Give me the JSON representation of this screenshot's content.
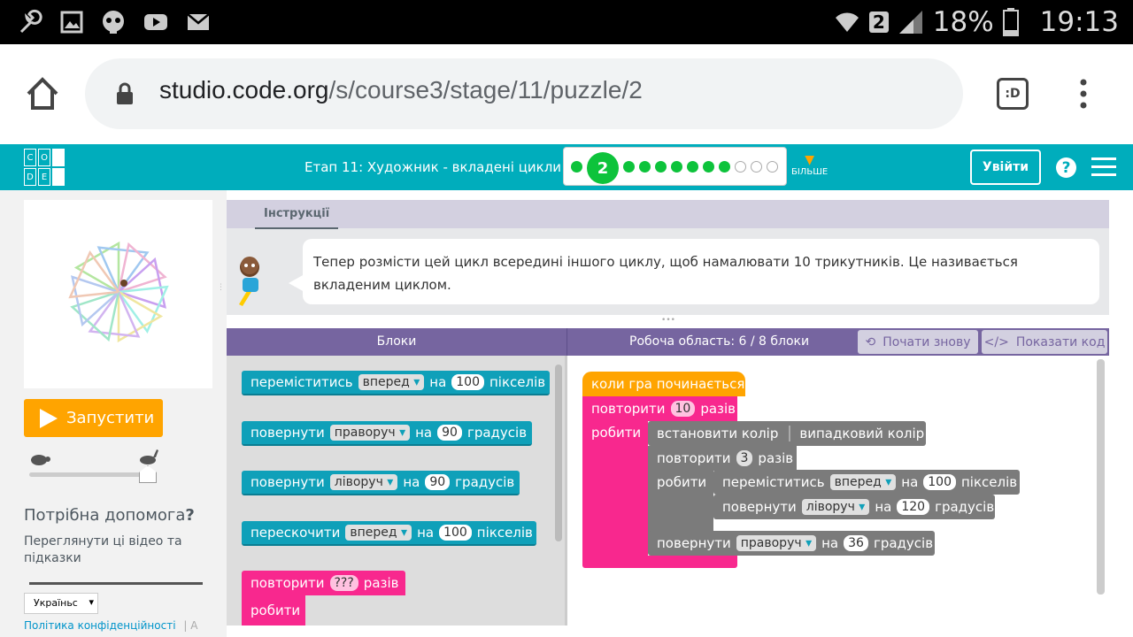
{
  "status_bar": {
    "battery": "18%",
    "time": "19:13",
    "sim": "2"
  },
  "browser": {
    "url_host": "studio.code.org",
    "url_path": "/s/course3/stage/11/puzzle/2",
    "tab_icon": ":D"
  },
  "nav": {
    "logo": [
      "C",
      "O",
      "D",
      "E"
    ],
    "stage_title": "Етап 11: Художник - вкладені цикли",
    "current_puzzle": "2",
    "more_label": "БІЛЬШЕ",
    "signin": "Увійти",
    "progress": {
      "completed_before": 1,
      "completed_after": 7,
      "remaining": 3
    }
  },
  "left": {
    "run": "Запустити",
    "help_title": "Потрібна допомога",
    "help_q": "?",
    "help_link": "Переглянути ці відео та підказки",
    "lang": "Україньс",
    "privacy": "Політика конфіденційності",
    "sep": "|",
    "cut": "A"
  },
  "instructions": {
    "tab": "Інструкції",
    "text": "Тепер розмісти цей цикл всередині іншого циклу, щоб намалювати 10 трикутників. Це називається вкладеним циклом."
  },
  "headers": {
    "toolbox": "Блоки",
    "workspace": "Робоча область: 6 / 8 блоки",
    "reset": "Почати знову",
    "show_code": "Показати код"
  },
  "toolbox": {
    "b1": {
      "a": "переміститись",
      "d": "вперед",
      "b": "на",
      "v": "100",
      "c": "пікселів"
    },
    "b2": {
      "a": "повернути",
      "d": "праворуч",
      "b": "на",
      "v": "90",
      "c": "градусів"
    },
    "b3": {
      "a": "повернути",
      "d": "ліворуч",
      "b": "на",
      "v": "90",
      "c": "градусів"
    },
    "b4": {
      "a": "перескочити",
      "d": "вперед",
      "b": "на",
      "v": "100",
      "c": "пікселів"
    },
    "b5": {
      "a": "повторити",
      "v": "???",
      "c": "разів",
      "do": "робити"
    }
  },
  "workspace": {
    "start": "коли гра починається",
    "rep": {
      "a": "повторити",
      "v": "10",
      "c": "разів",
      "do": "робити"
    },
    "color": {
      "a": "встановити колір",
      "v": "випадковий колір"
    },
    "rep2": {
      "a": "повторити",
      "v": "3",
      "c": "разів",
      "do": "робити"
    },
    "mv": {
      "a": "переміститись",
      "d": "вперед",
      "b": "на",
      "v": "100",
      "c": "пікселів"
    },
    "tl": {
      "a": "повернути",
      "d": "ліворуч",
      "b": "на",
      "v": "120",
      "c": "градусів"
    },
    "tr": {
      "a": "повернути",
      "d": "праворуч",
      "b": "на",
      "v": "36",
      "c": "градусів"
    }
  }
}
